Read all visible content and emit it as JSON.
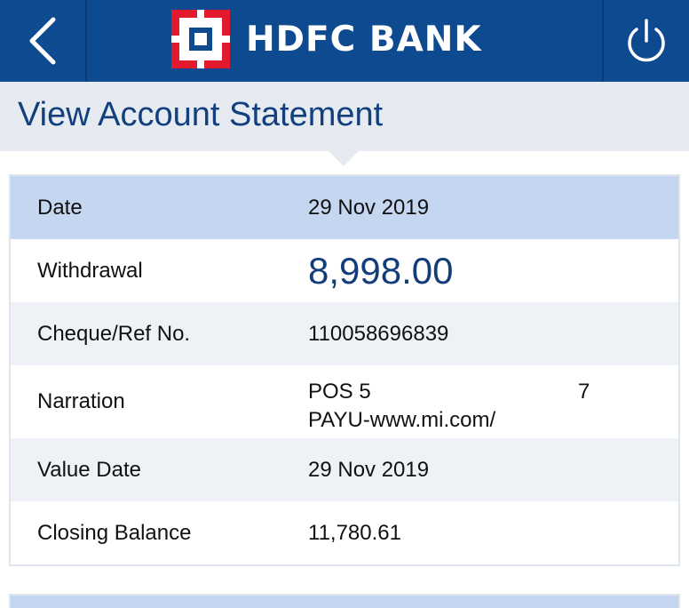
{
  "header": {
    "back_icon": "chevron-left-icon",
    "brand_name": "HDFC BANK",
    "power_icon": "power-icon",
    "colors": {
      "bar": "#0e4a8f",
      "logo_red": "#e3192e",
      "logo_blue": "#0e4a8f"
    }
  },
  "page": {
    "title": "View Account Statement"
  },
  "details": {
    "rows": [
      {
        "label": "Date",
        "value": "29 Nov 2019"
      },
      {
        "label": "Withdrawal",
        "value": "8,998.00"
      },
      {
        "label": "Cheque/Ref No.",
        "value": "110058696839"
      },
      {
        "label": "Narration",
        "value_line1a": "POS 5",
        "value_line1b": "7",
        "value_line2": "PAYU-www.mi.com/"
      },
      {
        "label": "Value Date",
        "value": "29 Nov 2019"
      },
      {
        "label": "Closing Balance",
        "value": "11,780.61"
      }
    ]
  }
}
